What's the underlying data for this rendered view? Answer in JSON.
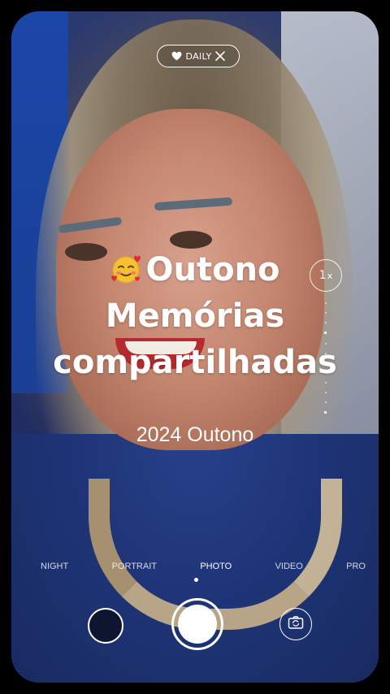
{
  "daily_chip": {
    "icon": "heart-icon",
    "label": "DAILY",
    "close_icon": "close-icon"
  },
  "zoom": {
    "value": "1",
    "unit": "x"
  },
  "headline": {
    "emoji": "smiling-face-with-hearts",
    "line1": "Outono",
    "line2": "Memórias",
    "line3": "compartilhadas"
  },
  "subtitle": "2024 Outono",
  "modes": {
    "items": [
      "NIGHT",
      "PORTRAIT",
      "PHOTO",
      "VIDEO",
      "PRO"
    ],
    "selected": "PHOTO"
  },
  "controls": {
    "gallery_icon": "gallery-thumbnail",
    "shutter_icon": "shutter-icon",
    "flip_icon": "camera-flip-icon"
  },
  "colors": {
    "overlay_text": "#ffffff",
    "frame": "#000000"
  }
}
